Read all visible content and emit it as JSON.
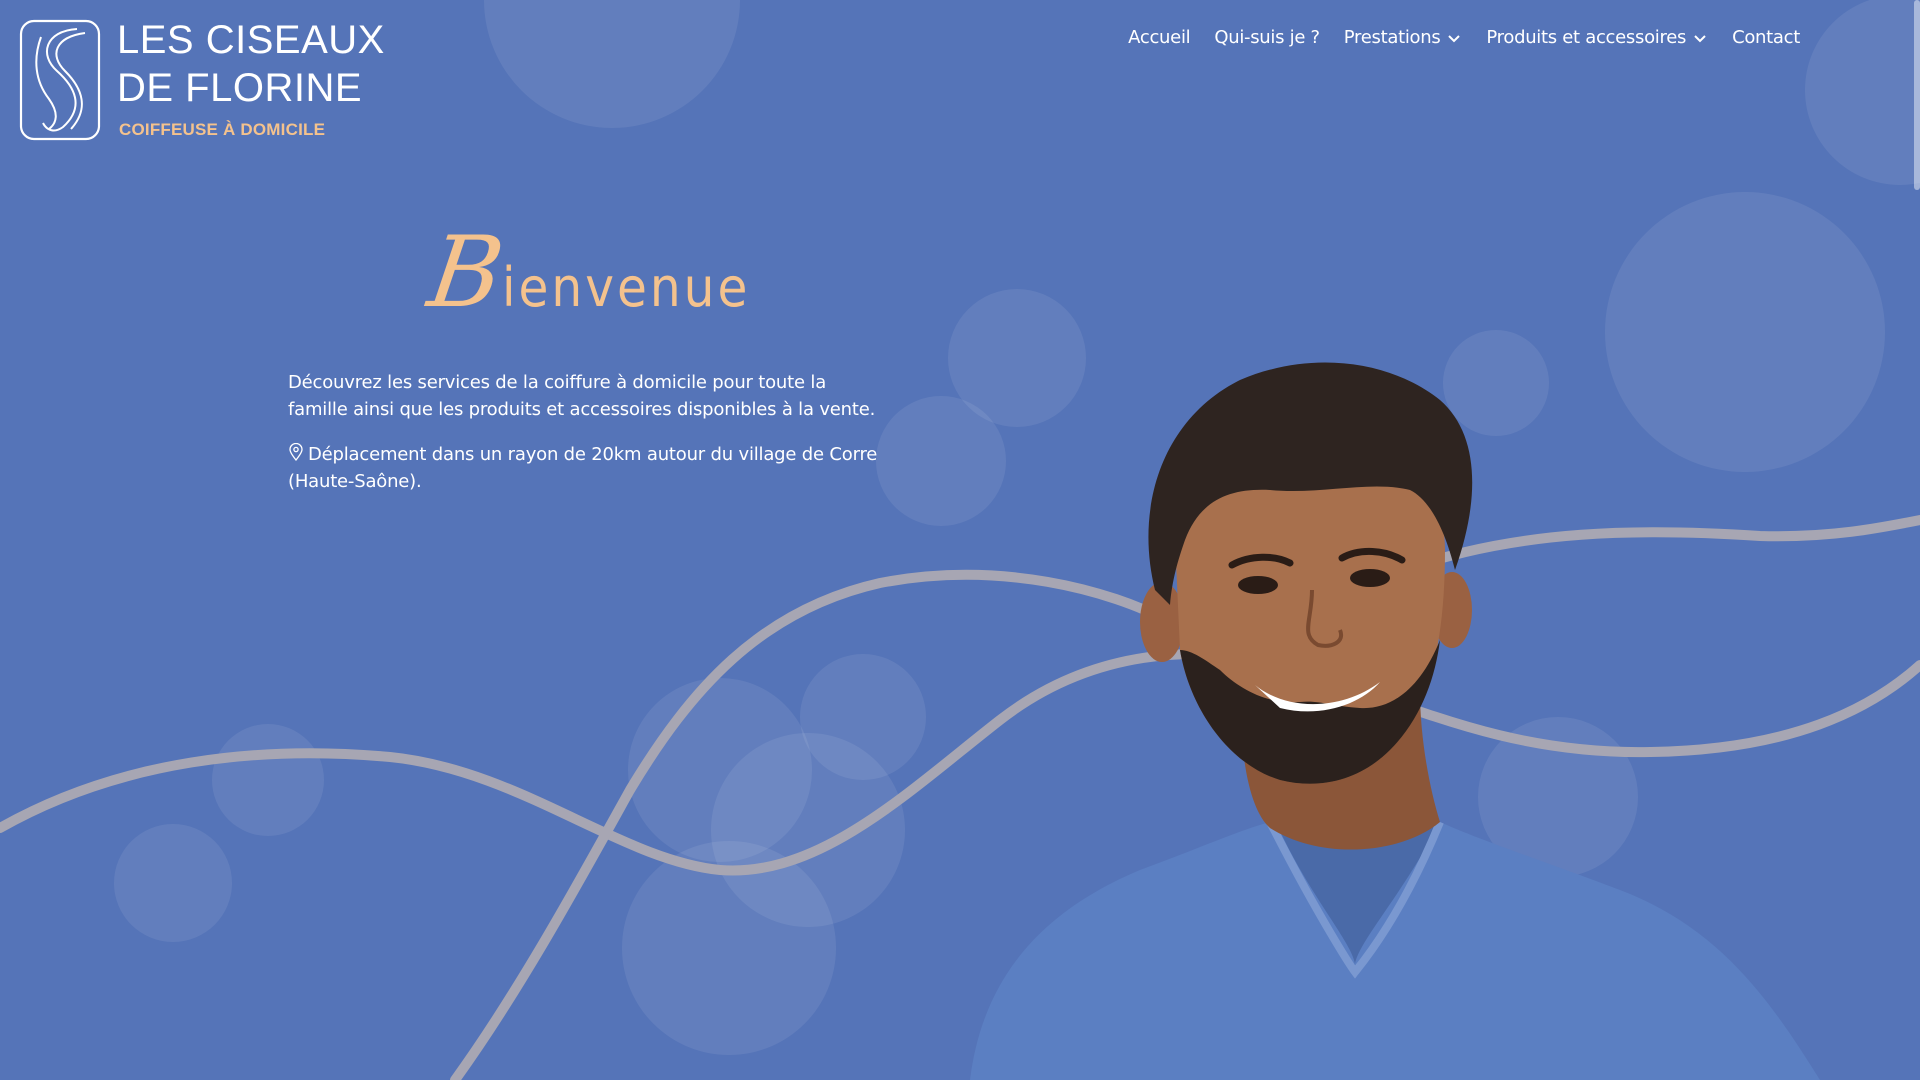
{
  "logo": {
    "line1": "LES CISEAUX",
    "line2": "DE FLORINE",
    "tagline": "COIFFEUSE À DOMICILE"
  },
  "nav": {
    "items": [
      {
        "label": "Accueil",
        "dropdown": false
      },
      {
        "label": "Qui-suis je ?",
        "dropdown": false
      },
      {
        "label": "Prestations",
        "dropdown": true
      },
      {
        "label": "Produits et accessoires",
        "dropdown": true
      },
      {
        "label": "Contact",
        "dropdown": false
      }
    ]
  },
  "hero": {
    "title_initial": "B",
    "title_rest": "ienvenue",
    "intro": "Découvrez les services de la coiffure à domicile pour toute la famille ainsi que les produits et accessoires disponibles à la vente.",
    "location": "Déplacement dans un rayon de 20km autour du village de Corre (Haute-Saône)."
  },
  "colors": {
    "background": "#5574b8",
    "accent": "#f4c28d",
    "wave": "#a7a6b3",
    "text": "#ffffff"
  },
  "icons": {
    "location": "map-pin-icon",
    "dropdown": "chevron-down-icon"
  }
}
